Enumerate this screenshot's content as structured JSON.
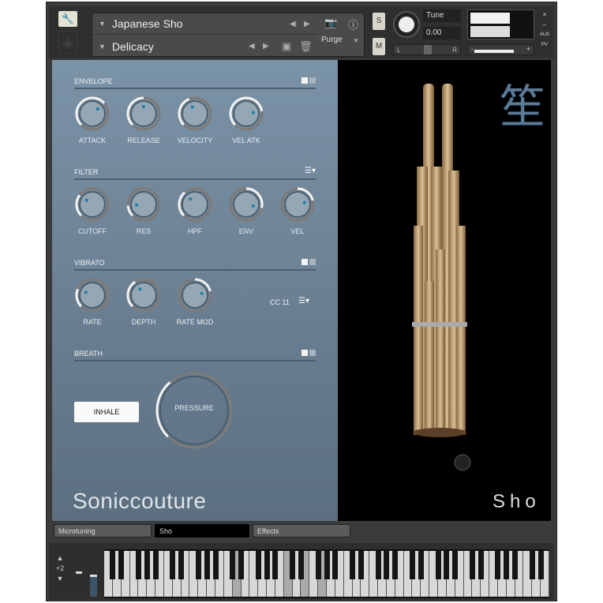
{
  "header": {
    "instrument_name": "Japanese Sho",
    "preset_name": "Delicacy",
    "purge_label": "Purge",
    "solo_label": "S",
    "mute_label": "M",
    "tune_label": "Tune",
    "tune_value": "0.00",
    "pan_left": "L",
    "pan_right": "R",
    "vol_minus": "-",
    "vol_plus": "+",
    "close": "×",
    "minimize": "–",
    "aux": "AUX",
    "pv": "PV"
  },
  "envelope": {
    "title": "ENVELOPE",
    "knobs": [
      {
        "label": "ATTACK",
        "value": 0.68
      },
      {
        "label": "RELEASE",
        "value": 0.5
      },
      {
        "label": "VELOCITY",
        "value": 0.42
      },
      {
        "label": "VEL ATK",
        "value": 0.8
      }
    ]
  },
  "filter": {
    "title": "FILTER",
    "knobs": [
      {
        "label": "CUTOFF",
        "value": 0.3
      },
      {
        "label": "RES",
        "value": 0.15
      },
      {
        "label": "HPF",
        "value": 0.35
      },
      {
        "label": "ENV",
        "value": 0.88,
        "bipolar": true
      },
      {
        "label": "VEL",
        "value": 0.78,
        "bipolar": true
      }
    ]
  },
  "vibrato": {
    "title": "VIBRATO",
    "cc_label": "CC 11",
    "knobs": [
      {
        "label": "RATE",
        "value": 0.25
      },
      {
        "label": "DEPTH",
        "value": 0.38
      },
      {
        "label": "RATE MOD",
        "value": 0.78,
        "bipolar": true
      }
    ]
  },
  "breath": {
    "title": "BREATH",
    "inhale_label": "INHALE",
    "pressure_label": "PRESSURE",
    "pressure_value": 0.35
  },
  "branding": {
    "company": "Soniccouture",
    "instrument_kanji": "笙",
    "instrument": "Sho"
  },
  "tabs": [
    {
      "label": "Microtuning"
    },
    {
      "label": "Sho",
      "active": true
    },
    {
      "label": "Effects"
    }
  ],
  "keyboard": {
    "octave_shift": "+2"
  },
  "colors": {
    "panel_top": "#7b93a7",
    "panel_bottom": "#5b6f80",
    "knob_dot": "#1e7fa8"
  }
}
